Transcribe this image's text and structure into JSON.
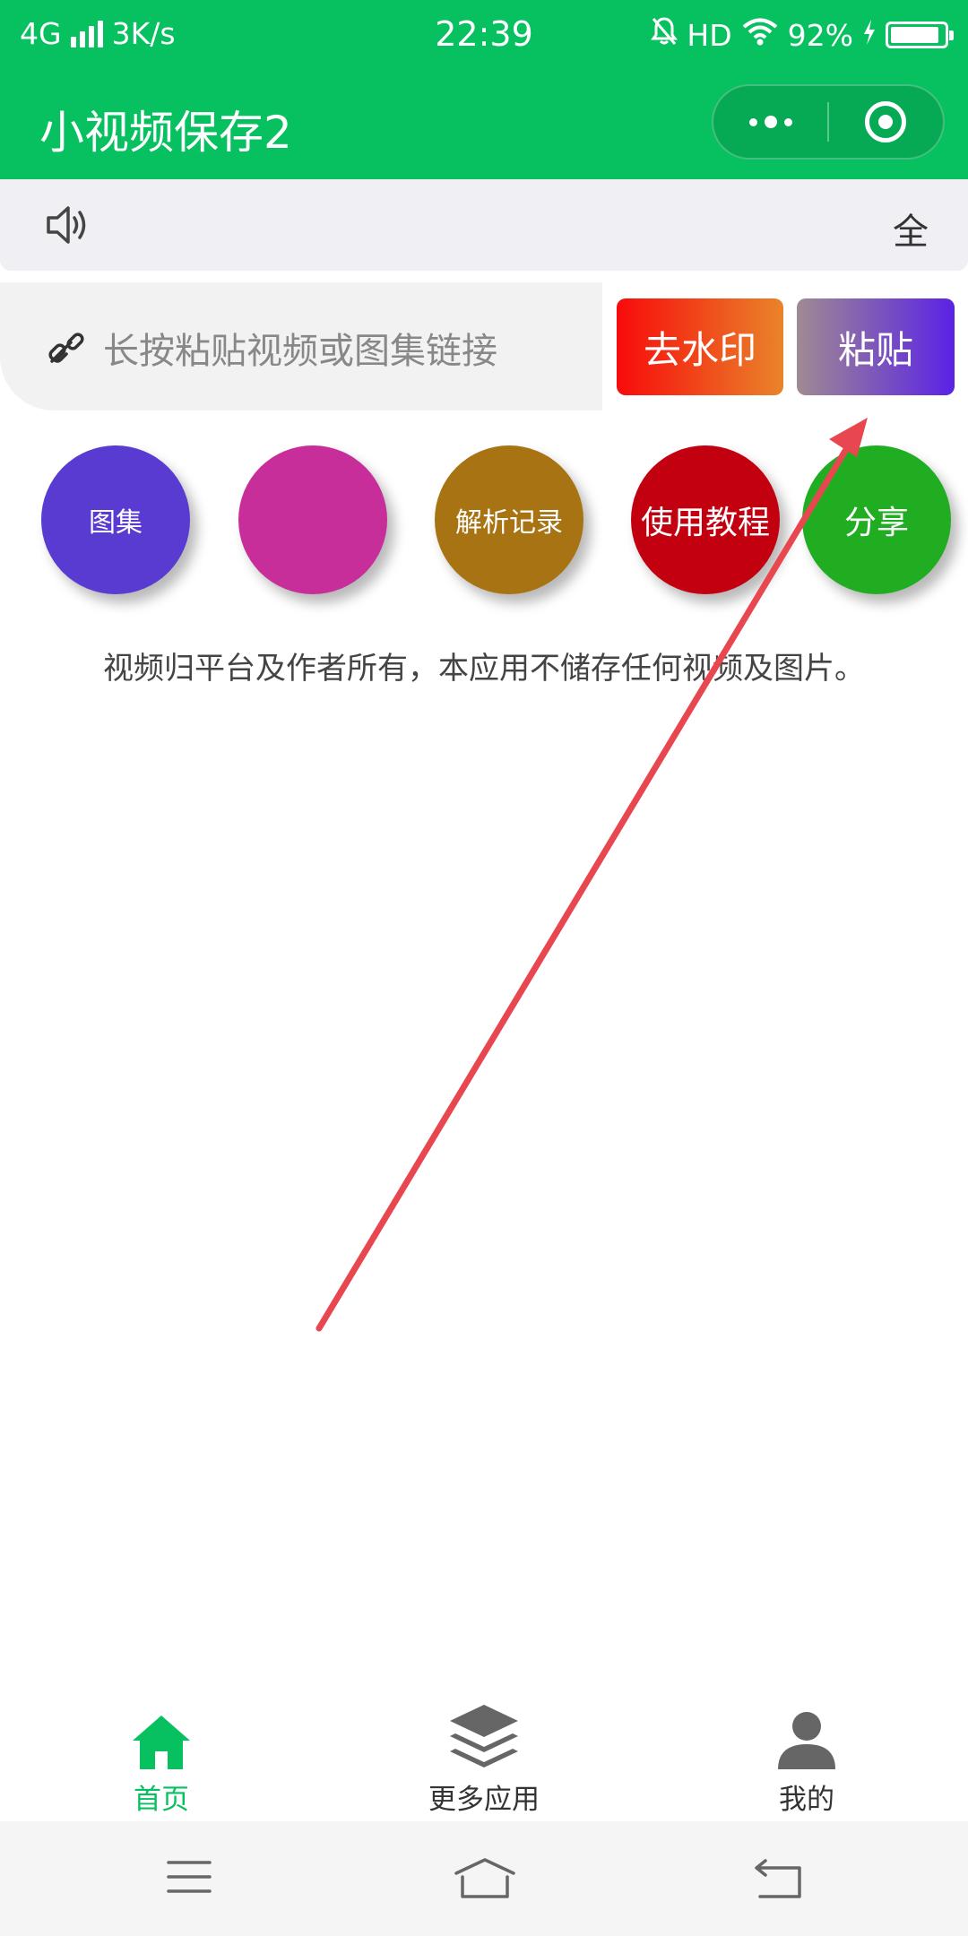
{
  "status_bar": {
    "network": "4G",
    "speed": "3K/s",
    "time": "22:39",
    "hd": "HD",
    "battery": "92%",
    "battery_level": 0.92
  },
  "nav": {
    "title": "小视频保存2",
    "more_icon": "more-dots-icon",
    "close_icon": "target-icon"
  },
  "notice": {
    "icon": "speaker-icon",
    "full_label": "全"
  },
  "input": {
    "icon": "link-icon",
    "placeholder": "长按粘贴视频或图集链接"
  },
  "buttons": {
    "remove_watermark": "去水印",
    "paste": "粘贴"
  },
  "circles": [
    {
      "label": "图集",
      "color": "#5a3bd1"
    },
    {
      "label": "",
      "color": "#c82e9a"
    },
    {
      "label": "解析记录",
      "color": "#a87312"
    },
    {
      "label": "使用教程",
      "color": "#c30010"
    },
    {
      "label": "分享",
      "color": "#21ad22"
    }
  ],
  "disclaimer": "视频归平台及作者所有，本应用不储存任何视频及图片。",
  "tabs": [
    {
      "label": "首页",
      "icon": "home-icon",
      "active": true
    },
    {
      "label": "更多应用",
      "icon": "layers-icon",
      "active": false
    },
    {
      "label": "我的",
      "icon": "user-icon",
      "active": false
    }
  ],
  "system_nav": [
    "menu-icon",
    "home-outline-icon",
    "back-icon"
  ],
  "colors": {
    "brand": "#07c160",
    "annotation_arrow": "#e8474f"
  }
}
